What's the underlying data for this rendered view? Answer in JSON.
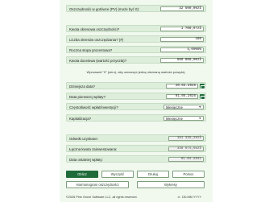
{
  "fields": {
    "pv_label": "Oszczędności w gotówce (PV) (może być 0):",
    "pv_value": "32 500,00zł",
    "deposit_label": "Kwota okresowa oszczędności?",
    "deposit_value": "1 700,97zł",
    "periods_label": "Liczba okresów oszczędzania? (#)",
    "periods_value": "180",
    "rate_label": "Roczna stopa procentowa?",
    "rate_value": "4,0000%",
    "fv_label": "Kwota docelowa (wartość przyszła)?",
    "fv_value": "500 000,00zł"
  },
  "note": "Wprowadź \"0\" (zero), aby oznaczyć jedną nieznaną wartość powyżej.",
  "dates": {
    "today_label": "Dzisiejsza data?",
    "today_value": "20.03.2026",
    "first_label": "Data pierwszej wpłaty?",
    "first_value": "01.05.2026",
    "freq_label": "Częstotliwość wpłat/inwestycji?",
    "freq_value": "Miesięczne",
    "comp_label": "Kapitalizacja?",
    "comp_value": "Miesięczne"
  },
  "results": {
    "interest_label": "Odsetki uzyskane:",
    "interest_value": "161 325,25zł",
    "total_label": "Łączna kwota zainwestowana:",
    "total_value": "338 674,65zł",
    "last_label": "Data ostatniej wpłaty:",
    "last_value": "01.04.2041"
  },
  "buttons": {
    "calc": "Oblicz",
    "clear": "Wyczyść",
    "print": "Drukuj",
    "help": "Pomoc",
    "schedule": "Harmonogram oszczędności",
    "chart": "Wykresy"
  },
  "footer": {
    "copyright": "©2026 Pine Grove Software LLC, all rights reserved.",
    "format": "d : DD.MM.YYYY"
  }
}
